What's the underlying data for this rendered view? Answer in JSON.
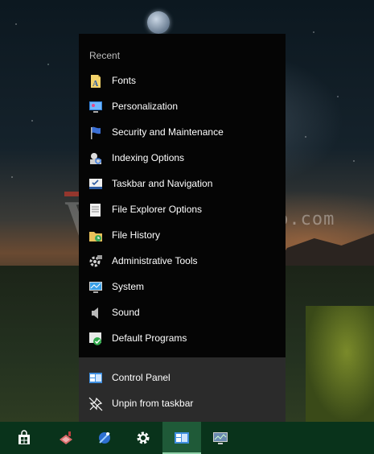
{
  "watermark": {
    "text": "http://winaero.com"
  },
  "jumplist": {
    "section_label": "Recent",
    "items": [
      {
        "label": "Fonts",
        "icon": "fonts-icon"
      },
      {
        "label": "Personalization",
        "icon": "personalization-icon"
      },
      {
        "label": "Security and Maintenance",
        "icon": "security-flag-icon"
      },
      {
        "label": "Indexing Options",
        "icon": "indexing-options-icon"
      },
      {
        "label": "Taskbar and Navigation",
        "icon": "taskbar-navigation-icon"
      },
      {
        "label": "File Explorer Options",
        "icon": "file-explorer-options-icon"
      },
      {
        "label": "File History",
        "icon": "file-history-icon"
      },
      {
        "label": "Administrative Tools",
        "icon": "administrative-tools-icon"
      },
      {
        "label": "System",
        "icon": "system-monitor-icon"
      },
      {
        "label": "Sound",
        "icon": "speaker-icon"
      },
      {
        "label": "Default Programs",
        "icon": "default-programs-icon"
      }
    ],
    "actions": [
      {
        "label": "Control Panel",
        "icon": "control-panel-icon"
      },
      {
        "label": "Unpin from taskbar",
        "icon": "unpin-icon"
      }
    ]
  },
  "taskbar": {
    "buttons": [
      {
        "icon": "store-icon"
      },
      {
        "icon": "pinned-app-icon"
      },
      {
        "icon": "pinned-app-2-icon"
      },
      {
        "icon": "settings-gear-icon"
      },
      {
        "icon": "control-panel-icon",
        "active": true
      },
      {
        "icon": "monitor-app-icon"
      }
    ]
  },
  "colors": {
    "menu_background": "#050505",
    "menu_bottom_background": "#2b2b2b",
    "taskbar": "#09331b",
    "taskbar_active": "#1f5a38"
  }
}
